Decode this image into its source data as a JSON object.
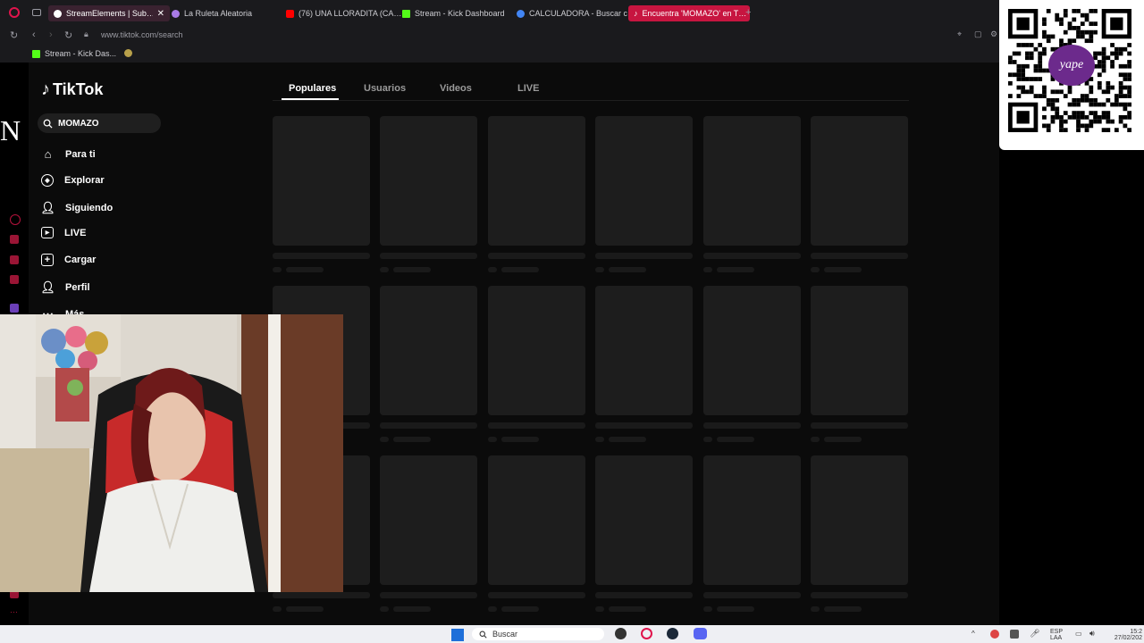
{
  "browser": {
    "tabs": [
      {
        "label": "StreamElements | Sub…",
        "color": "#ffffff"
      },
      {
        "label": "La Ruleta Aleatoria",
        "color": "#a77be5"
      },
      {
        "label": "(76) UNA LLORADITA (CA…",
        "color": "#ff0000"
      },
      {
        "label": "Stream - Kick Dashboard",
        "color": "#53fc18"
      },
      {
        "label": "CALCULADORA - Buscar c…",
        "color": "#4285f4"
      },
      {
        "label": "Encuentra 'MOMAZO' en T…",
        "color": "#000000"
      }
    ],
    "url": "www.tiktok.com/search",
    "bookmark": "Stream - Kick Das..."
  },
  "tiktok": {
    "logo": "TikTok",
    "search_value": "MOMAZO",
    "nav": [
      {
        "label": "Para ti",
        "icon": "home-icon"
      },
      {
        "label": "Explorar",
        "icon": "compass-icon"
      },
      {
        "label": "Siguiendo",
        "icon": "following-icon"
      },
      {
        "label": "LIVE",
        "icon": "live-icon"
      },
      {
        "label": "Cargar",
        "icon": "upload-icon"
      },
      {
        "label": "Perfil",
        "icon": "profile-icon"
      },
      {
        "label": "Más",
        "icon": "more-icon"
      }
    ],
    "tabs": [
      "Populares",
      "Usuarios",
      "Videos",
      "LIVE"
    ],
    "active_tab": "Populares"
  },
  "overlay": {
    "n_letter": "N",
    "qr_brand": "yape"
  },
  "taskbar": {
    "search_placeholder": "Buscar",
    "lang": "ESP",
    "lang2": "LAA",
    "time": "15:2",
    "date": "27/02/202"
  }
}
